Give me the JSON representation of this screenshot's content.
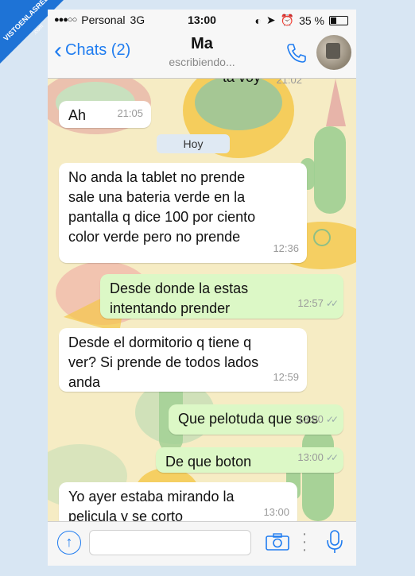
{
  "status": {
    "carrier": "Personal",
    "network": "3G",
    "time": "13:00",
    "battery_text": "35 %",
    "battery_level": 0.35
  },
  "header": {
    "back_label": "Chats (2)",
    "contact_name": "Ma",
    "status_text": "escribiendo..."
  },
  "chat": {
    "clipped_top_text": "ta voy",
    "clipped_top_time": "21:02",
    "date_divider": "Hoy",
    "messages": [
      {
        "side": "in",
        "lines": [
          "Ah"
        ],
        "time": "21:05"
      },
      {
        "side": "in",
        "lines": [
          "No anda la tablet no prende",
          "sale una bateria verde en la",
          "pantalla q dice 100 por ciento",
          "color verde pero no prende"
        ],
        "time": "12:36"
      },
      {
        "side": "out",
        "lines": [
          "Desde donde la estas",
          "intentando prender"
        ],
        "time": "12:57",
        "ticks": "✓✓"
      },
      {
        "side": "in",
        "lines": [
          "Desde el dormitorio q tiene q",
          "ver? Si prende de todos lados",
          "anda"
        ],
        "time": "12:59"
      },
      {
        "side": "out",
        "lines": [
          "Que pelotuda que sos"
        ],
        "time": "13:00",
        "ticks": "✓✓"
      },
      {
        "side": "out",
        "lines": [
          "De que boton"
        ],
        "time": "13:00",
        "ticks": "✓✓"
      },
      {
        "side": "in",
        "lines": [
          "Yo ayer estaba mirando la",
          "pelicula y se corto"
        ],
        "time": "13:00"
      }
    ]
  },
  "watermark": {
    "text": "VISTOENLASREDES",
    "sub": ".com"
  },
  "colors": {
    "accent": "#1f7cf0",
    "outgoing": "#dcf8c6",
    "incoming": "#ffffff",
    "wallpaper": "#f6ecc4"
  }
}
